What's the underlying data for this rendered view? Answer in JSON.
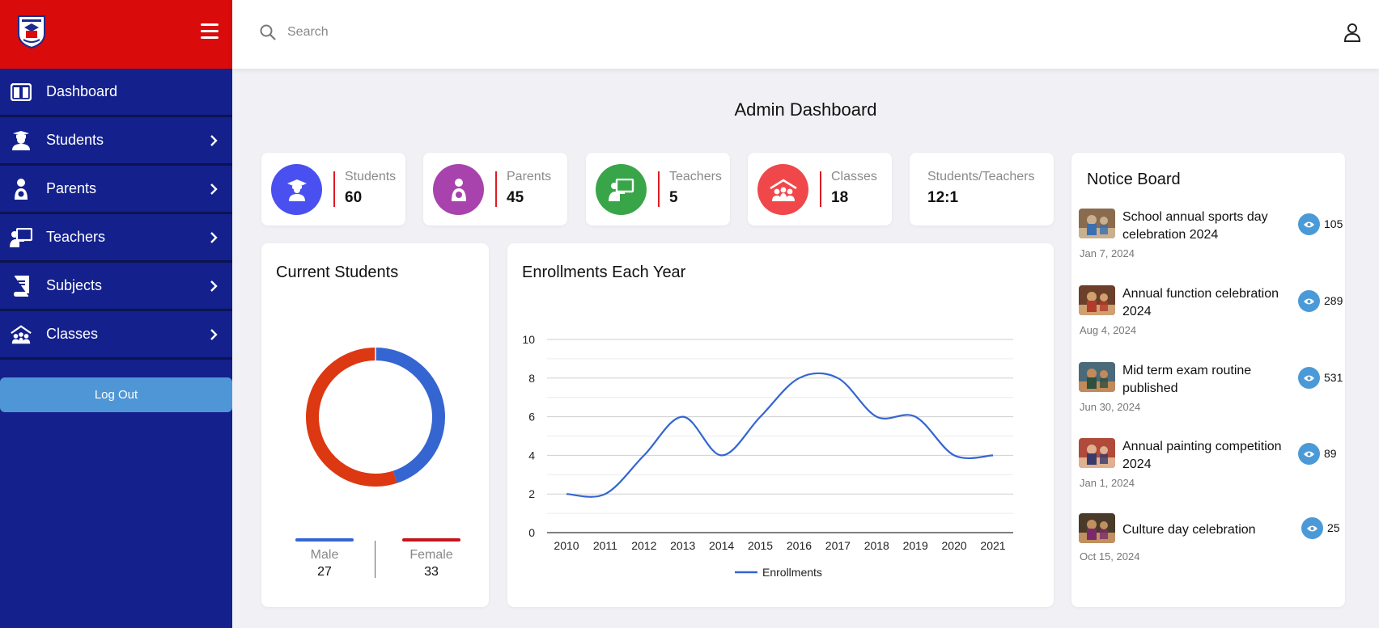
{
  "colors": {
    "sidebar": "#14208c",
    "header": "#d90b0b",
    "logout": "#4f96d6",
    "students_icon": "#4a50f0",
    "parents_icon": "#a843ad",
    "teachers_icon": "#39a549",
    "classes_icon": "#f0474b",
    "male": "#3465d1",
    "female": "#dc3812",
    "line": "#3465d1"
  },
  "sidebar": {
    "items": [
      {
        "label": "Dashboard",
        "icon": "dashboard-icon"
      },
      {
        "label": "Students",
        "icon": "student-icon"
      },
      {
        "label": "Parents",
        "icon": "parent-icon"
      },
      {
        "label": "Teachers",
        "icon": "teacher-icon"
      },
      {
        "label": "Subjects",
        "icon": "book-icon"
      },
      {
        "label": "Classes",
        "icon": "class-icon"
      }
    ],
    "logout_label": "Log Out"
  },
  "search": {
    "placeholder": "Search"
  },
  "page": {
    "title": "Admin Dashboard"
  },
  "stats": [
    {
      "label": "Students",
      "value": "60"
    },
    {
      "label": "Parents",
      "value": "45"
    },
    {
      "label": "Teachers",
      "value": "5"
    },
    {
      "label": "Classes",
      "value": "18"
    },
    {
      "label": "Students/Teachers",
      "value": "12:1"
    }
  ],
  "current_students": {
    "title": "Current Students",
    "male_label": "Male",
    "male_value": "27",
    "female_label": "Female",
    "female_value": "33"
  },
  "enrollments": {
    "title": "Enrollments Each Year"
  },
  "chart_data": [
    {
      "type": "pie",
      "title": "Current Students",
      "categories": [
        "Male",
        "Female"
      ],
      "values": [
        27,
        33
      ]
    },
    {
      "type": "line",
      "title": "Enrollments Each Year",
      "x": [
        "2010",
        "2011",
        "2012",
        "2013",
        "2014",
        "2015",
        "2016",
        "2017",
        "2018",
        "2019",
        "2020",
        "2021"
      ],
      "series": [
        {
          "name": "Enrollments",
          "values": [
            2,
            2,
            4,
            6,
            4,
            6,
            8,
            8,
            6,
            6,
            4,
            4
          ]
        }
      ],
      "ylim": [
        0,
        10
      ],
      "yticks": [
        "0",
        "2",
        "4",
        "6",
        "8",
        "10"
      ],
      "grid": true,
      "legend": "bottom"
    }
  ],
  "notice_board": {
    "title": "Notice Board",
    "items": [
      {
        "title": "School annual sports day celebration 2024",
        "date": "Jan 7, 2024",
        "views": "105"
      },
      {
        "title": "Annual function celebration 2024",
        "date": "Aug 4, 2024",
        "views": "289"
      },
      {
        "title": "Mid term exam routine published",
        "date": "Jun 30, 2024",
        "views": "531"
      },
      {
        "title": "Annual painting competition 2024",
        "date": "Jan 1, 2024",
        "views": "89"
      },
      {
        "title": "Culture day celebration",
        "date": "Oct 15, 2024",
        "views": "25"
      }
    ]
  }
}
